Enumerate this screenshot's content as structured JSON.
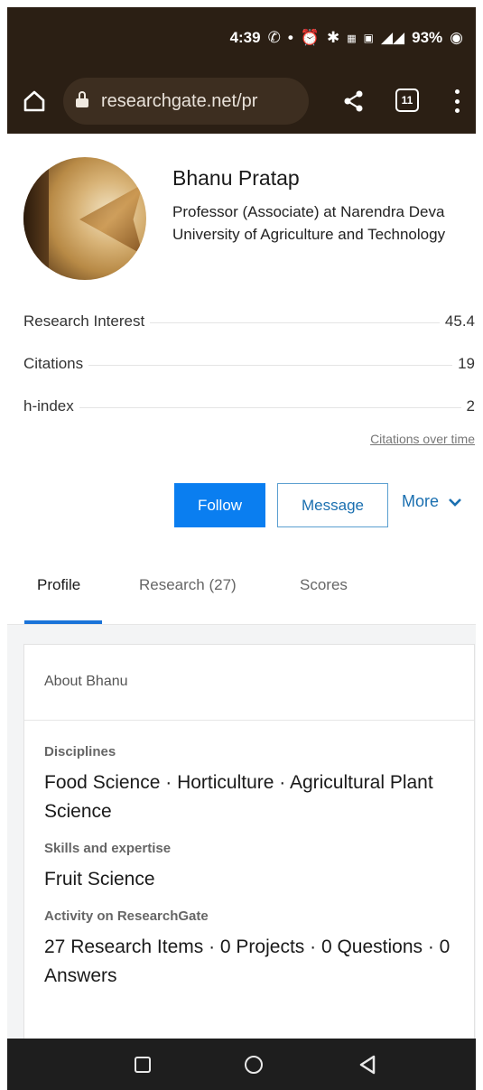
{
  "status_bar": {
    "time": "4:39",
    "battery": "93%"
  },
  "browser": {
    "url": "researchgate.net/pr",
    "tab_count": "11"
  },
  "profile": {
    "name": "Bhanu Pratap",
    "position": "Professor (Associate) at Narendra Deva University of Agriculture and Technology"
  },
  "stats": [
    {
      "label": "Research Interest",
      "value": "45.4"
    },
    {
      "label": "Citations",
      "value": "19"
    },
    {
      "label": "h-index",
      "value": "2"
    }
  ],
  "citations_link": "Citations over time",
  "actions": {
    "follow": "Follow",
    "message": "Message",
    "more": "More"
  },
  "tabs": [
    {
      "label": "Profile",
      "active": true
    },
    {
      "label": "Research (27)",
      "active": false
    },
    {
      "label": "Scores",
      "active": false
    }
  ],
  "about": {
    "title": "About Bhanu",
    "disciplines_heading": "Disciplines",
    "disciplines": "Food Science · Horticulture · Agricultural Plant Science",
    "skills_heading": "Skills and expertise",
    "skills": "Fruit Science",
    "activity_heading": "Activity on ResearchGate",
    "activity": "27 Research Items · 0 Projects · 0 Questions · 0 Answers"
  },
  "colors": {
    "browser_chrome": "#2b1f14",
    "follow_blue": "#0a7ef0",
    "link_blue": "#1a6fb0"
  }
}
